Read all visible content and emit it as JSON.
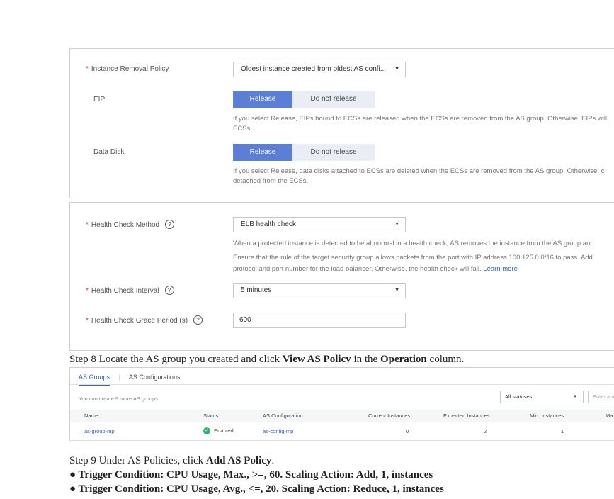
{
  "form1": {
    "removal_policy_label": "Instance Removal Policy",
    "removal_policy_value": "Oldest instance created from oldest AS confi...",
    "eip_label": "EIP",
    "eip_release": "Release",
    "eip_no_release": "Do not release",
    "eip_hint_1": "If you select Release, EIPs bound to ECSs are released when the ECSs are removed from the AS group. Otherwise, EIPs will",
    "eip_hint_2": "ECSs.",
    "disk_label": "Data Disk",
    "disk_release": "Release",
    "disk_no_release": "Do not release",
    "disk_hint_1": "If you select Release, data disks attached to ECSs are deleted when the ECSs are removed from the AS group. Otherwise, c",
    "disk_hint_2": "detached from the ECSs."
  },
  "form2": {
    "health_method_label": "Health Check Method",
    "health_method_value": "ELB health check",
    "health_hint_1": "When a protected instance is detected to be abnormal in a health check, AS removes the instance from the AS group and",
    "health_hint_2": "Ensure that the rule of the target security group allows packets from the port with IP address 100.125.0.0/16 to pass. Add",
    "health_hint_3": "protocol and port number for the load balancer. Otherwise, the health check will fail.",
    "learn_more": "Learn more",
    "interval_label": "Health Check Interval",
    "interval_value": "5 minutes",
    "grace_label": "Health Check Grace Period (s)",
    "grace_value": "600"
  },
  "step8": {
    "prefix": "Step 8 Locate the AS group you created and click ",
    "bold1": "View AS Policy",
    "mid": " in the ",
    "bold2": "Operation",
    "suffix": " column."
  },
  "as_table": {
    "tab_groups": "AS Groups",
    "tab_configs": "AS Configurations",
    "quota_text": "You can create 9 more AS groups.",
    "status_filter": "All statuses",
    "search_placeholder": "Enter a na",
    "headers": [
      "Name",
      "Status",
      "AS Configuration",
      "Current Instances",
      "Expected Instances",
      "Min. Instances",
      "Ma"
    ],
    "row": {
      "name": "as-group-mp",
      "status": "Enabled",
      "config": "as-config-mp",
      "current": "0",
      "expected": "2",
      "min": "1"
    }
  },
  "step9": {
    "prefix": "Step 9 Under AS Policies, click ",
    "bold": "Add AS Policy",
    "suffix": ".",
    "bullet1": "● Trigger Condition: CPU Usage, Max., >=, 60. Scaling Action: Add, 1, instances",
    "bullet2": "● Trigger Condition: CPU Usage, Avg., <=, 20. Scaling Action: Reduce, 1, instances"
  },
  "colors": {
    "accent": "#5b7fd7",
    "link": "#3860c6",
    "required": "#e0342b",
    "enabled": "#35b06e"
  }
}
